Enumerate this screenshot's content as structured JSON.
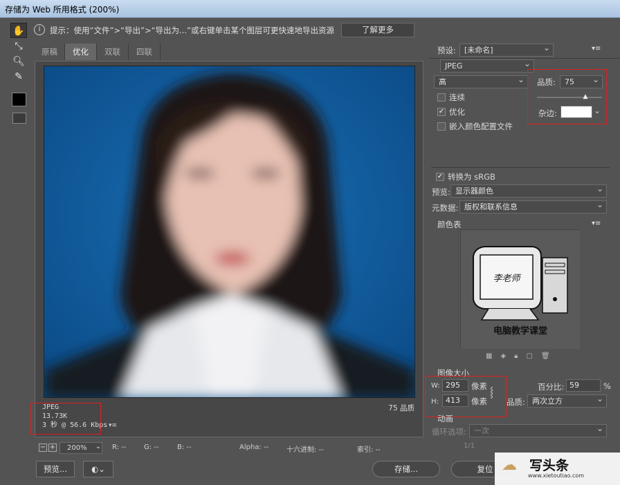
{
  "window": {
    "title": "存储为 Web 所用格式 (200%)"
  },
  "toolbar": {
    "icons": [
      "hand-icon",
      "slice-select-icon",
      "zoom-icon",
      "eyedropper-icon"
    ]
  },
  "hint": {
    "text": "提示：使用“文件”>“导出”>“导出为...”或右键单击某个图层可更快速地导出资源",
    "button": "了解更多"
  },
  "tabs": [
    {
      "label": "原稿",
      "active": false
    },
    {
      "label": "优化",
      "active": true
    },
    {
      "label": "双联",
      "active": false
    },
    {
      "label": "四联",
      "active": false
    }
  ],
  "preview_info": {
    "format": "JPEG",
    "size": "13.73K",
    "speed": "3 秒 @ 56.6 Kbps",
    "quality": "75 品质"
  },
  "status": {
    "zoom": "200%",
    "r": "R: --",
    "g": "G: --",
    "b": "B: --",
    "alpha": "Alpha: --",
    "hex": "十六进制: --",
    "index": "索引: --"
  },
  "buttons": {
    "preview": "预览...",
    "save": "存储...",
    "reset": "复位"
  },
  "settings": {
    "preset_label": "预设:",
    "preset_value": "[未命名]",
    "format": "JPEG",
    "quality_level": "高",
    "quality_label": "品质:",
    "quality_value": "75",
    "quality_slider": 0.75,
    "progressive_label": "连续",
    "progressive_checked": false,
    "optimized_label": "优化",
    "optimized_checked": true,
    "embed_profile_label": "嵌入颜色配置文件",
    "embed_profile_checked": false,
    "matte_label": "杂边:",
    "matte_color": "#ffffff",
    "convert_srgb_label": "转换为 sRGB",
    "convert_srgb_checked": true,
    "preview_label": "预览:",
    "preview_value": "显示器颜色",
    "metadata_label": "元数据:",
    "metadata_value": "版权和联系信息"
  },
  "color_table": {
    "title": "颜色表",
    "logo_text_1": "李老师",
    "logo_text_2": "电脑教学课堂"
  },
  "image_size": {
    "title": "图像大小",
    "w_label": "W:",
    "w_value": "295",
    "h_label": "H:",
    "h_value": "413",
    "unit": "像素",
    "percent_label": "百分比:",
    "percent_value": "59",
    "percent_unit": "%",
    "quality_label": "品质:",
    "quality_value": "两次立方"
  },
  "animation": {
    "title": "动画",
    "loop_label": "循环选项:",
    "loop_value": "一次",
    "frame": "1/1"
  },
  "watermark": {
    "brand": "头条",
    "url": "www.xietoutiao.com"
  },
  "colors": {
    "highlight": "#e02020",
    "photo_bg": "#0f5a9c"
  }
}
